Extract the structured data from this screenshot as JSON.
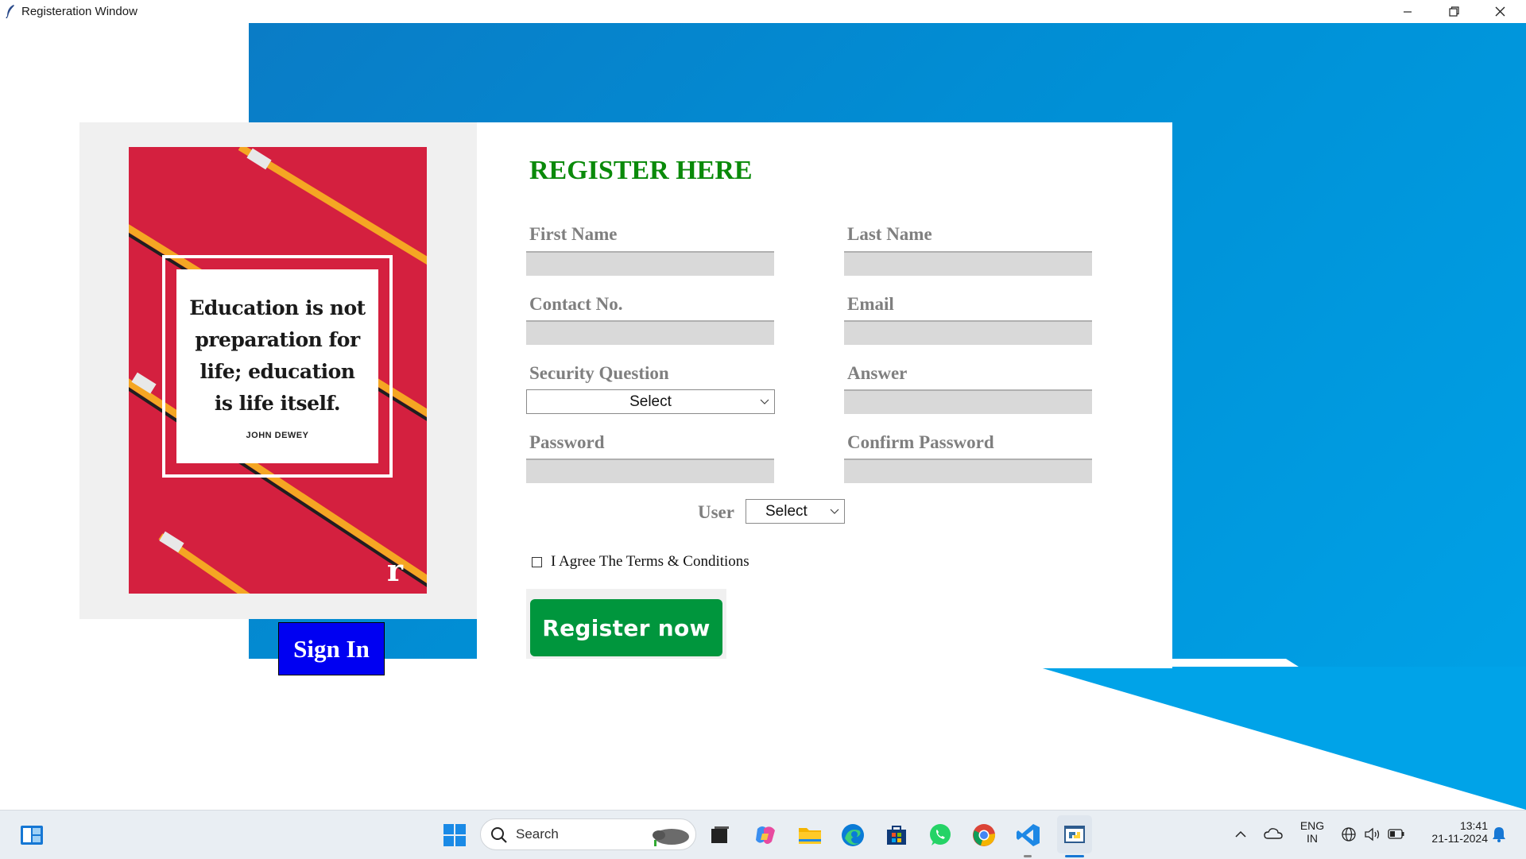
{
  "window": {
    "title": "Registeration Window",
    "controls": [
      "minimize",
      "restore",
      "close"
    ]
  },
  "poster": {
    "quote_lines": [
      "Education is not",
      "preparation for",
      "life; education",
      "is life itself."
    ],
    "author": "JOHN DEWEY",
    "logo": "r"
  },
  "sign_in": {
    "label": "Sign In"
  },
  "form": {
    "heading": "REGISTER HERE",
    "first_name": {
      "label": "First Name",
      "value": ""
    },
    "last_name": {
      "label": "Last Name",
      "value": ""
    },
    "contact": {
      "label": "Contact No.",
      "value": ""
    },
    "email": {
      "label": "Email",
      "value": ""
    },
    "security_question": {
      "label": "Security Question",
      "selected": "Select"
    },
    "answer": {
      "label": "Answer",
      "value": ""
    },
    "password": {
      "label": "Password",
      "value": ""
    },
    "confirm_password": {
      "label": "Confirm Password",
      "value": ""
    },
    "user": {
      "label": "User",
      "selected": "Select"
    },
    "terms": {
      "label": "I Agree The Terms & Conditions",
      "checked": false
    },
    "register_button": "Register now"
  },
  "colors": {
    "heading": "#0a8a0a",
    "label": "#7f7f7f",
    "sign_in_bg": "#0000f2",
    "register_bg": "#00963d",
    "background_blue": "#0090d6",
    "poster_red": "#d4203f"
  },
  "taskbar": {
    "search_label": "Search",
    "pinned": [
      "widgets-icon",
      "windows-start-icon",
      "task-view-icon",
      "copilot-icon",
      "file-explorer-icon",
      "edge-icon",
      "microsoft-store-icon",
      "whatsapp-icon",
      "chrome-icon",
      "vscode-icon",
      "python-idle-icon"
    ],
    "tray": {
      "language": "ENG",
      "region": "IN",
      "time": "13:41",
      "date": "21-11-2024"
    }
  }
}
